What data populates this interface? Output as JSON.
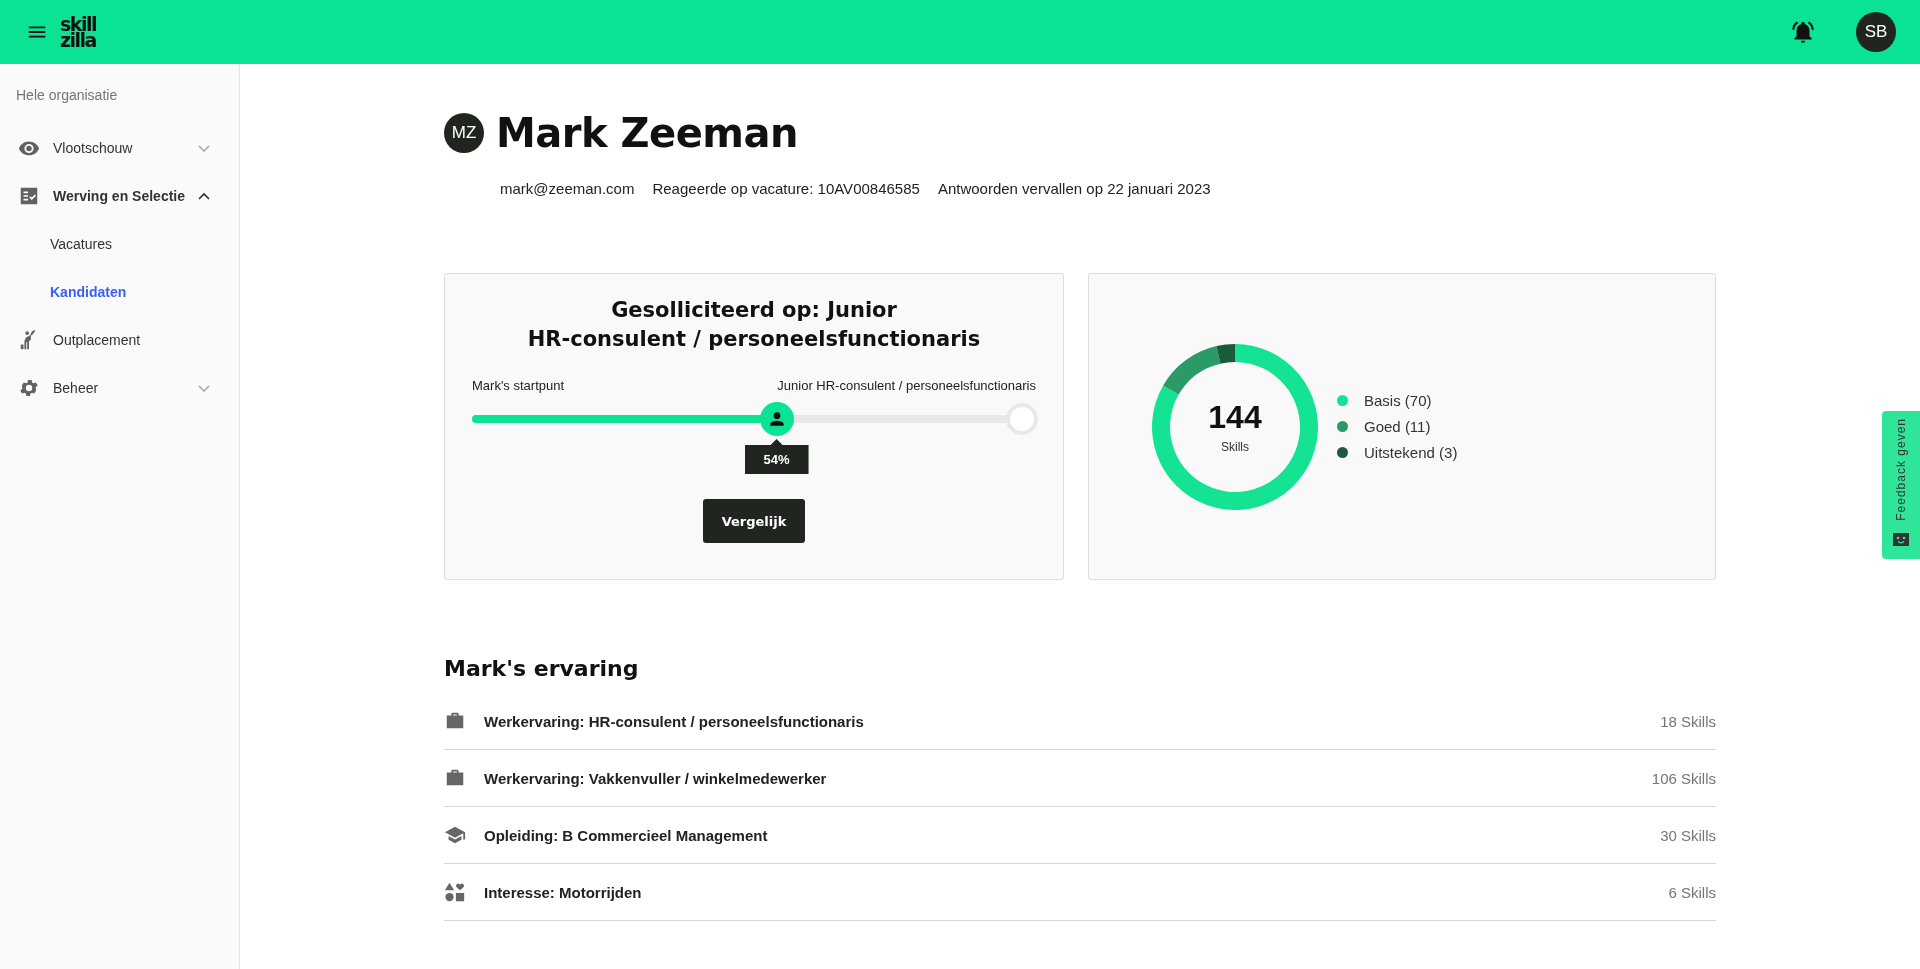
{
  "header": {
    "logo": [
      "skill",
      "zilla"
    ],
    "user_initials": "SB"
  },
  "sidebar": {
    "scope": "Hele organisatie",
    "items": [
      {
        "label": "Vlootschouw",
        "selected": false,
        "expanded": false
      },
      {
        "label": "Werving en Selectie",
        "selected": true,
        "expanded": true,
        "children": [
          {
            "label": "Vacatures",
            "selected": false
          },
          {
            "label": "Kandidaten",
            "selected": true
          }
        ]
      },
      {
        "label": "Outplacement",
        "selected": false
      },
      {
        "label": "Beheer",
        "selected": false,
        "expanded": false
      }
    ]
  },
  "candidate": {
    "initials": "MZ",
    "name": "Mark Zeeman",
    "meta": [
      "mark@zeeman.com",
      "Reageerde op vacature: 10AV00846585",
      "Antwoorden vervallen op 22 januari 2023"
    ]
  },
  "match_card": {
    "title": "Gesolliciteerd op: Junior HR-consulent / personeelsfunctionaris",
    "start_label": "Mark's startpunt",
    "end_label": "Junior HR-consulent / personeelsfunctionaris",
    "level": 0.54,
    "reading": "54%",
    "button": "Vergelijk"
  },
  "skills_card": {
    "total": "144",
    "legend": [
      {
        "count": "(70)",
        "color": "#13e393"
      },
      {
        "count": "(11)",
        "color": "#2a9a67"
      },
      {
        "count": "(3)",
        "color": "#1d5a3d"
      }
    ],
    "chart_data": {
      "type": "donut",
      "categories": [
        "Basis",
        "Goed",
        "Uitstekend"
      ],
      "series": [
        {
          "name": "Skills",
          "values": [
            83.3,
            13.1,
            3.6
          ]
        }
      ]
    }
  },
  "experience": {
    "title": "Mark's ervaring",
    "rows": [
      {
        "kind": "work",
        "label": "Werkervaring: HR-consulent / personeelsfunctionaris",
        "count": "18 Skills"
      },
      {
        "kind": "work",
        "label": "Werkervaring: Vakkenvuller / winkelmedewerker",
        "count": "106 Skills"
      },
      {
        "kind": "education",
        "label": "Opleiding: B Commercieel Management",
        "count": "30 Skills"
      },
      {
        "kind": "interest",
        "label": "Interesse: Motorrijden",
        "count": "6 Skills"
      }
    ]
  },
  "feedback_tab": {
    "label": "Feedback geven"
  }
}
